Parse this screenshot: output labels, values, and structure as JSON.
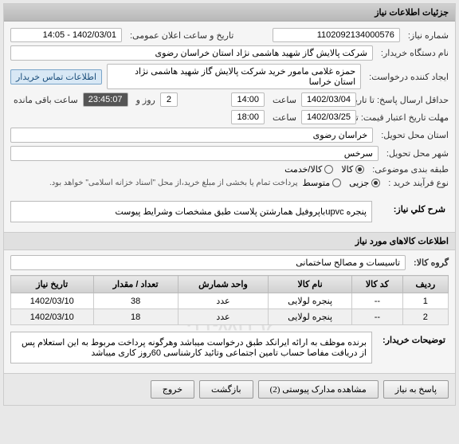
{
  "panel_title": "جزئیات اطلاعات نیاز",
  "form": {
    "req_no_label": "شماره نیاز:",
    "req_no": "1102092134000576",
    "announce_label": "تاریخ و ساعت اعلان عمومی:",
    "announce": "1402/03/01 - 14:05",
    "buyer_label": "نام دستگاه خریدار:",
    "buyer": "شرکت پالایش گاز شهید هاشمی نژاد   استان خراسان رضوی",
    "creator_label": "ایجاد کننده درخواست:",
    "creator": "حمزه غلامی مامور خرید شرکت پالایش گاز شهید هاشمی نژاد   استان خراسا",
    "contact_link": "اطلاعات تماس خریدار",
    "resp_deadline_label": "حداقل ارسال پاسخ: تا تاریخ:",
    "resp_date": "1402/03/04",
    "hour_label": "ساعت",
    "resp_time": "14:00",
    "day_and_label": "روز و",
    "days": "2",
    "countdown": "23:45:07",
    "remaining": "ساعت باقی مانده",
    "validity_label": "مهلت تاریخ اعتبار قیمت: تا تاریخ:",
    "validity_date": "1402/03/25",
    "validity_time": "18:00",
    "province_label": "استان محل تحویل:",
    "province": "خراسان رضوی",
    "city_label": "شهر محل تحویل:",
    "city": "سرخس",
    "class_label": "طبقه بندی موضوعی:",
    "class_goods": "کالا",
    "class_service": "کالا/خدمت",
    "buy_type_label": "نوع فرآیند خرید :",
    "buy_partial": "جزیی",
    "buy_medium": "متوسط",
    "buy_note": "پرداخت تمام یا بخشی از مبلغ خرید،از محل \"اسناد خزانه اسلامی\" خواهد بود."
  },
  "desc": {
    "title_label": "شرح کلي نياز:",
    "title": "پنجره upvcباپروفیل همارشتن پلاست طبق مشخصات وشرایط پیوست",
    "items_header": "اطلاعات کالاهای مورد نیاز",
    "group_label": "گروه کالا:",
    "group": "تاسیسات و مصالح ساختمانی",
    "explain_label": "توضیحات خریدار:",
    "explain": "برنده موظف به ارائه ایرانکد طبق درخواست میباشد وهرگونه پرداخت مربوط به این استعلام پس از دریافت مفاصا حساب تامین اجتماعی وتائید کارشناسی 60روز کاری میباشد"
  },
  "table": {
    "headers": {
      "row": "ردیف",
      "code": "کد کالا",
      "name": "نام کالا",
      "unit": "واحد شمارش",
      "qty": "تعداد / مقدار",
      "date": "تاریخ نیاز"
    },
    "rows": [
      {
        "idx": "1",
        "code": "--",
        "name": "پنجره لولایی",
        "unit": "عدد",
        "qty": "38",
        "date": "1402/03/10"
      },
      {
        "idx": "2",
        "code": "--",
        "name": "پنجره لولایی",
        "unit": "عدد",
        "qty": "18",
        "date": "1402/03/10"
      }
    ]
  },
  "buttons": {
    "respond": "پاسخ به نیاز",
    "attachments": "مشاهده مدارک پیوستی (2)",
    "back": "بازگشت",
    "exit": "خروج"
  },
  "watermark": "۰۲۱-۸۸۳۴۹۶"
}
